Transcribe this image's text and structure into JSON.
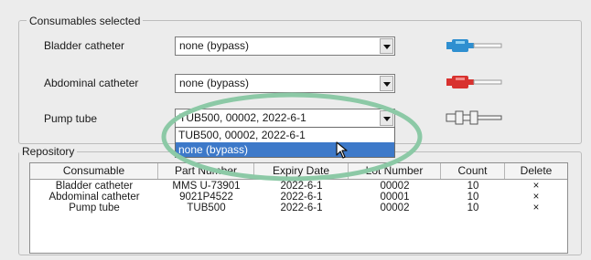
{
  "consumables": {
    "title": "Consumables selected",
    "rows": [
      {
        "label": "Bladder catheter",
        "value": "none (bypass)",
        "icon": "blue-catheter-connector-icon"
      },
      {
        "label": "Abdominal catheter",
        "value": "none (bypass)",
        "icon": "red-catheter-connector-icon"
      },
      {
        "label": "Pump tube",
        "value": "TUB500, 00002, 2022-6-1",
        "icon": "pump-tube-icon"
      }
    ],
    "dropdown_options": [
      "TUB500, 00002, 2022-6-1",
      "none (bypass)"
    ],
    "dropdown_selected_index": 1
  },
  "repository": {
    "title": "Repository",
    "columns": [
      "Consumable",
      "Part Number",
      "Expiry Date",
      "Lot Number",
      "Count",
      "Delete"
    ],
    "rows": [
      [
        "Bladder catheter",
        "MMS U-73901",
        "2022-6-1",
        "00002",
        "10",
        "×"
      ],
      [
        "Abdominal catheter",
        "9021P4522",
        "2022-6-1",
        "00001",
        "10",
        "×"
      ],
      [
        "Pump tube",
        "TUB500",
        "2022-6-1",
        "00002",
        "10",
        "×"
      ]
    ]
  },
  "colors": {
    "highlight_ellipse": "#8cc9a6",
    "selection": "#3d79c9",
    "blue_connector": "#2f8fd0",
    "red_connector": "#d8322f"
  }
}
